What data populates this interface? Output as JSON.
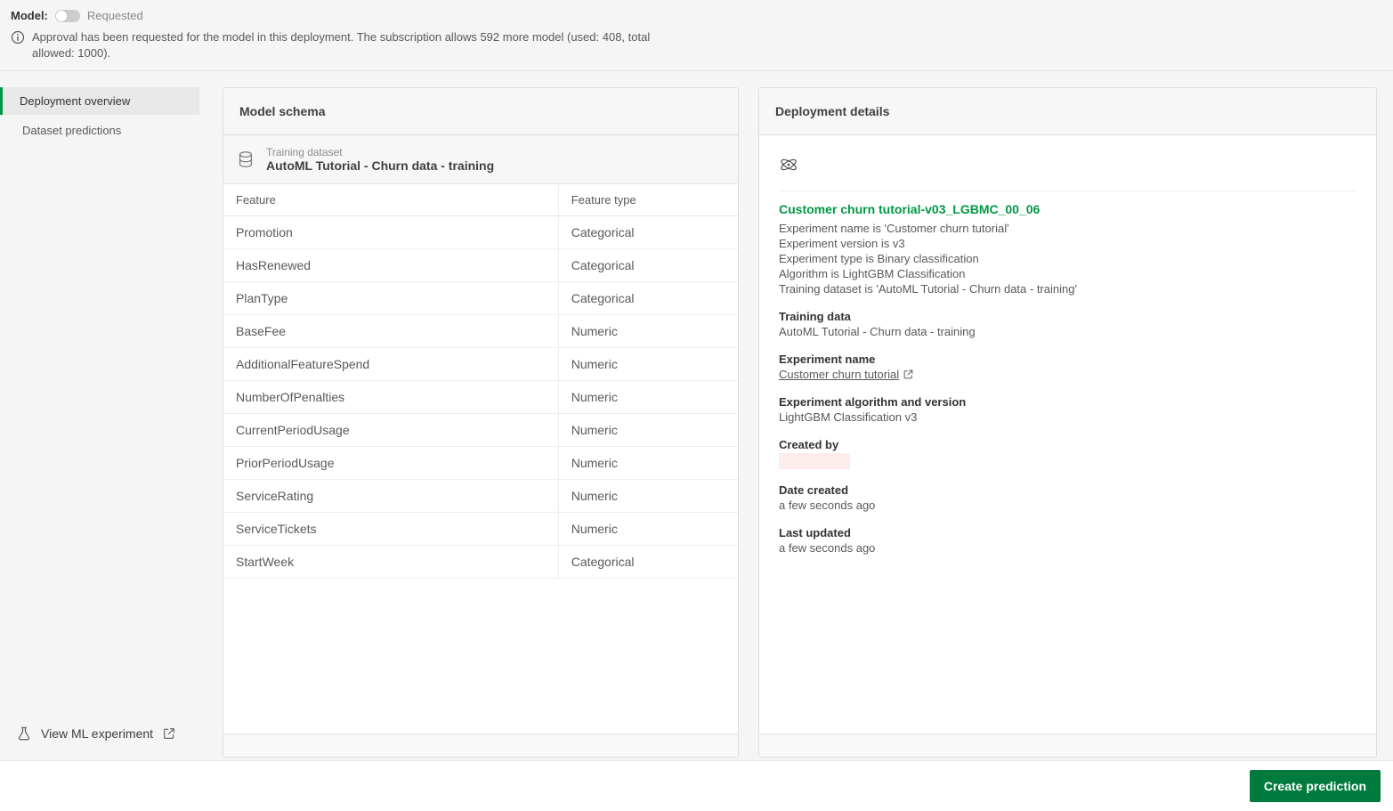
{
  "topbar": {
    "model_label": "Model:",
    "approval_status": "Requested",
    "info_text": "Approval has been requested for the model in this deployment. The subscription allows 592 more model (used: 408, total allowed: 1000)."
  },
  "sidebar": {
    "items": [
      {
        "label": "Deployment overview",
        "active": true
      },
      {
        "label": "Dataset predictions",
        "active": false
      }
    ],
    "view_experiment_label": "View ML experiment"
  },
  "schema_panel": {
    "title": "Model schema",
    "dataset_label": "Training dataset",
    "dataset_name": "AutoML Tutorial - Churn data - training",
    "columns": {
      "feature": "Feature",
      "type": "Feature type"
    },
    "rows": [
      {
        "feature": "Promotion",
        "type": "Categorical"
      },
      {
        "feature": "HasRenewed",
        "type": "Categorical"
      },
      {
        "feature": "PlanType",
        "type": "Categorical"
      },
      {
        "feature": "BaseFee",
        "type": "Numeric"
      },
      {
        "feature": "AdditionalFeatureSpend",
        "type": "Numeric"
      },
      {
        "feature": "NumberOfPenalties",
        "type": "Numeric"
      },
      {
        "feature": "CurrentPeriodUsage",
        "type": "Numeric"
      },
      {
        "feature": "PriorPeriodUsage",
        "type": "Numeric"
      },
      {
        "feature": "ServiceRating",
        "type": "Numeric"
      },
      {
        "feature": "ServiceTickets",
        "type": "Numeric"
      },
      {
        "feature": "StartWeek",
        "type": "Categorical"
      }
    ]
  },
  "details_panel": {
    "title": "Deployment details",
    "model_name": "Customer churn tutorial-v03_LGBMC_00_06",
    "summary_lines": [
      "Experiment name is 'Customer churn tutorial'",
      "Experiment version is v3",
      "Experiment type is Binary classification",
      "Algorithm is LightGBM Classification",
      "Training dataset is 'AutoML Tutorial - Churn data - training'"
    ],
    "blocks": {
      "training_data": {
        "label": "Training data",
        "value": "AutoML Tutorial - Churn data - training"
      },
      "experiment_name": {
        "label": "Experiment name",
        "value": "Customer churn tutorial"
      },
      "algorithm": {
        "label": "Experiment algorithm and version",
        "value": "LightGBM Classification v3"
      },
      "created_by": {
        "label": "Created by",
        "value": ""
      },
      "date_created": {
        "label": "Date created",
        "value": "a few seconds ago"
      },
      "last_updated": {
        "label": "Last updated",
        "value": "a few seconds ago"
      }
    }
  },
  "footer": {
    "button_label": "Create prediction"
  }
}
